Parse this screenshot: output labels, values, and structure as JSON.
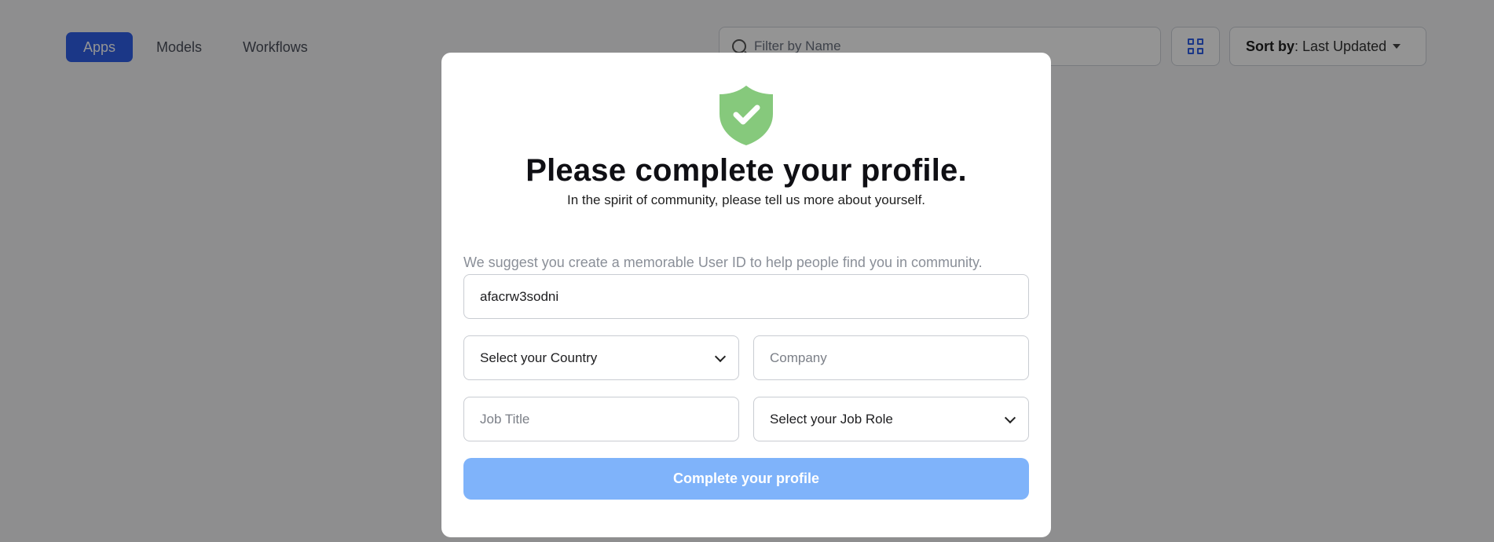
{
  "background": {
    "tabs": [
      {
        "label": "Apps",
        "active": true
      },
      {
        "label": "Models",
        "active": false
      },
      {
        "label": "Workflows",
        "active": false
      }
    ],
    "search": {
      "placeholder": "Filter by Name"
    },
    "sort": {
      "label": "Sort by",
      "value": ": Last Updated"
    }
  },
  "modal": {
    "title": "Please complete your profile.",
    "subtitle": "In the spirit of community, please tell us more about yourself.",
    "hint": "We suggest you create a memorable User ID to help people find you in community.",
    "user_id": "afacrw3sodni",
    "country_select": "Select your Country",
    "company_placeholder": "Company",
    "job_title_placeholder": "Job Title",
    "job_role_select": "Select your Job Role",
    "submit_label": "Complete your profile",
    "accent_color": "#7fb3fa",
    "shield_color": "#86c97c"
  }
}
